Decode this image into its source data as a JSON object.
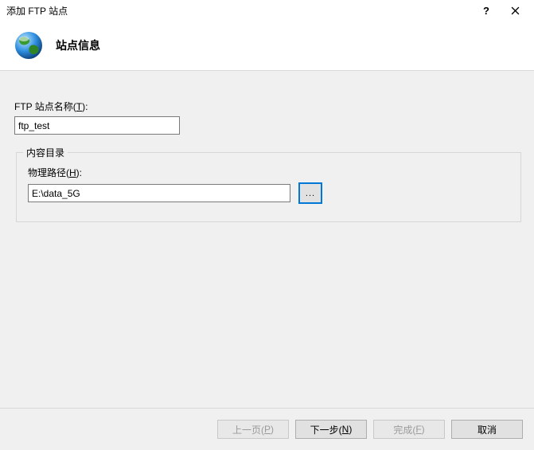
{
  "window": {
    "title": "添加 FTP 站点",
    "help_symbol": "?",
    "close_symbol": "✕"
  },
  "header": {
    "heading": "站点信息"
  },
  "form": {
    "site_name_label_pre": "FTP 站点名称(",
    "site_name_accel": "T",
    "site_name_label_post": "):",
    "site_name_value": "ftp_test",
    "groupbox_title": "内容目录",
    "path_label_pre": "物理路径(",
    "path_accel": "H",
    "path_label_post": "):",
    "path_value": "E:\\data_5G",
    "browse_label": "..."
  },
  "footer": {
    "prev_pre": "上一页(",
    "prev_accel": "P",
    "prev_post": ")",
    "next_pre": "下一步(",
    "next_accel": "N",
    "next_post": ")",
    "finish_pre": "完成(",
    "finish_accel": "F",
    "finish_post": ")",
    "cancel": "取消"
  }
}
